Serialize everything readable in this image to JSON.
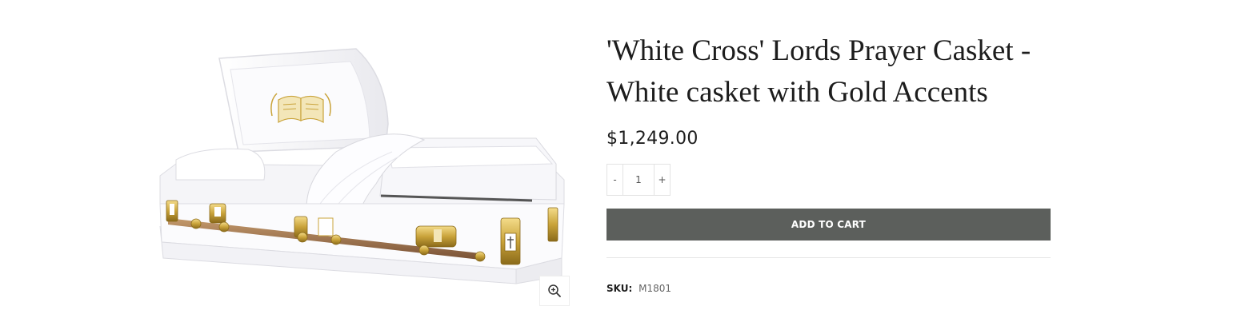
{
  "product": {
    "title_line1": "'White Cross' Lords Prayer Casket -",
    "title_line2": "White casket with Gold Accents",
    "price": "$1,249.00",
    "quantity": {
      "minus_label": "-",
      "value": "1",
      "plus_label": "+"
    },
    "add_to_cart_label": "ADD TO CART",
    "sku_label": "SKU:",
    "sku_value": "M1801"
  },
  "icons": {
    "zoom": "zoom-in-icon"
  },
  "colors": {
    "button_bg": "#5c5f5c",
    "text": "#1d1d1d",
    "gold": "#c9a33a"
  }
}
